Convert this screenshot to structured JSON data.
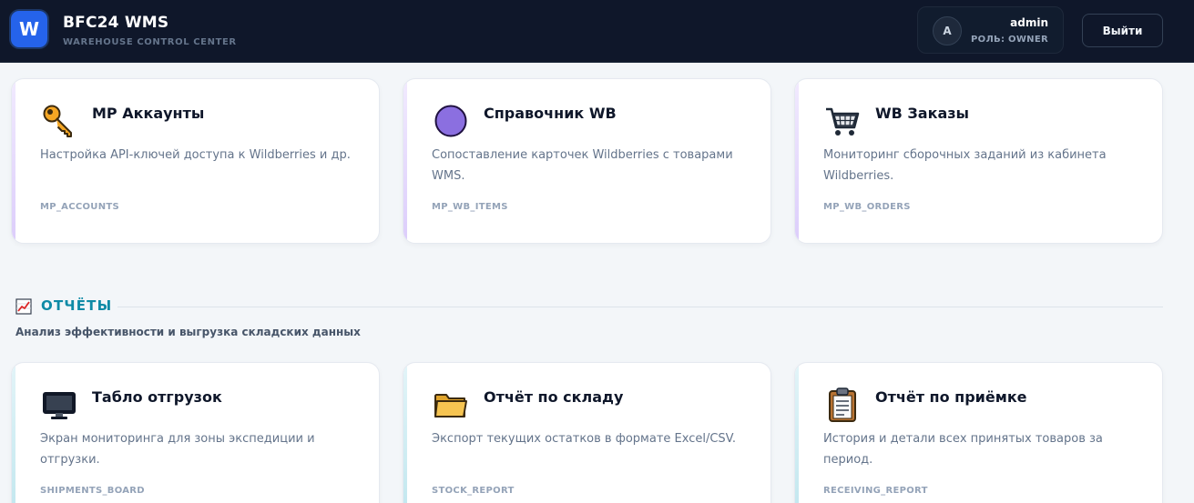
{
  "header": {
    "logo_letter": "W",
    "title": "BFC24 WMS",
    "subtitle": "WAREHOUSE CONTROL CENTER",
    "user_initial": "A",
    "user_name": "admin",
    "user_role": "РОЛЬ: OWNER",
    "logout_label": "Выйти"
  },
  "marketplace_cards": [
    {
      "icon": "key-icon",
      "title": "MP Аккаунты",
      "description": "Настройка API-ключей доступа к Wildberries и др.",
      "code": "MP_ACCOUNTS"
    },
    {
      "icon": "purple-circle-icon",
      "title": "Справочник WB",
      "description": "Сопоставление карточек Wildberries с товарами WMS.",
      "code": "MP_WB_ITEMS"
    },
    {
      "icon": "shopping-cart-icon",
      "title": "WB Заказы",
      "description": "Мониторинг сборочных заданий из кабинета Wildberries.",
      "code": "MP_WB_ORDERS"
    }
  ],
  "reports_section": {
    "icon": "chart-increasing-icon",
    "title": "ОТЧЁТЫ",
    "subtitle": "Анализ эффективности и выгрузка складских данных"
  },
  "report_cards": [
    {
      "icon": "monitor-icon",
      "title": "Табло отгрузок",
      "description": "Экран мониторинга для зоны экспедиции и отгрузки.",
      "code": "SHIPMENTS_BOARD"
    },
    {
      "icon": "folder-icon",
      "title": "Отчёт по складу",
      "description": "Экспорт текущих остатков в формате Excel/CSV.",
      "code": "STOCK_REPORT"
    },
    {
      "icon": "clipboard-icon",
      "title": "Отчёт по приёмке",
      "description": "История и детали всех принятых товаров за период.",
      "code": "RECEIVING_REPORT"
    }
  ],
  "colors": {
    "topbar": "#0f172a",
    "logo": "#2563eb",
    "section_accent": "#0e8aa6",
    "marketplace_accent": "#dccdfb",
    "reports_accent": "#bfe6ee"
  }
}
